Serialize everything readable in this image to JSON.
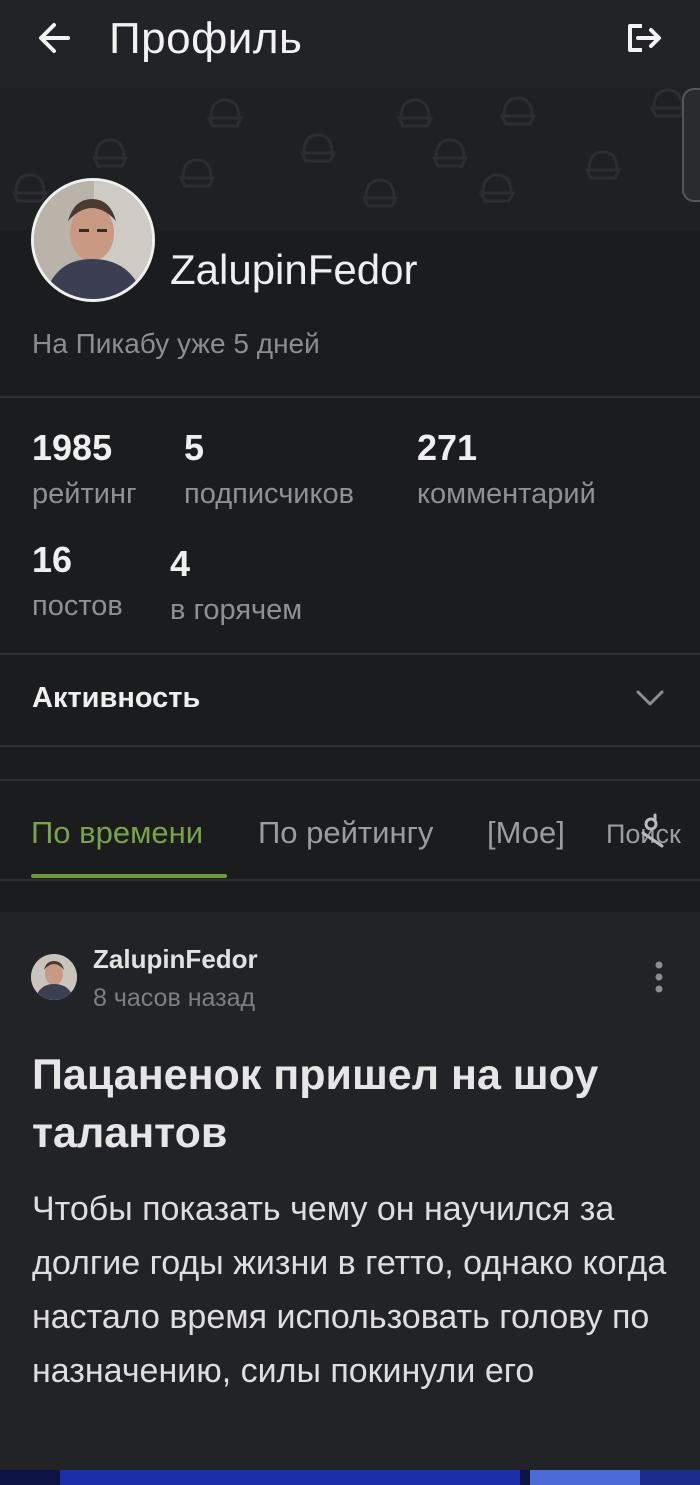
{
  "header": {
    "title": "Профиль",
    "back_icon": "arrow-left-icon",
    "logout_icon": "logout-icon"
  },
  "profile": {
    "username": "ZalupinFedor",
    "member_since": "На Пикабу уже 5 дней",
    "stats": [
      {
        "value": "1985",
        "label": "рейтинг"
      },
      {
        "value": "5",
        "label": "подписчиков"
      },
      {
        "value": "271",
        "label": "комментарий"
      },
      {
        "value": "16",
        "label": "постов"
      },
      {
        "value": "4",
        "label": "в горячем"
      }
    ]
  },
  "activity": {
    "label": "Активность",
    "icon": "chevron-down-icon"
  },
  "tabs": [
    {
      "label": "По времени",
      "active": true
    },
    {
      "label": "По рейтингу",
      "active": false
    },
    {
      "label": "[Мое]",
      "active": false
    },
    {
      "label": "Поиск",
      "active": false
    }
  ],
  "post": {
    "author": "ZalupinFedor",
    "time": "8 часов назад",
    "title": "Пацаненок пришел на шоу талантов",
    "body": "Чтобы показать чему он научился за долгие годы жизни в гетто, однако когда настало время использовать голову по назначению, силы покинули его"
  },
  "colors": {
    "accent": "#7aa349",
    "background": "#1b1c1e",
    "card": "#222327"
  }
}
